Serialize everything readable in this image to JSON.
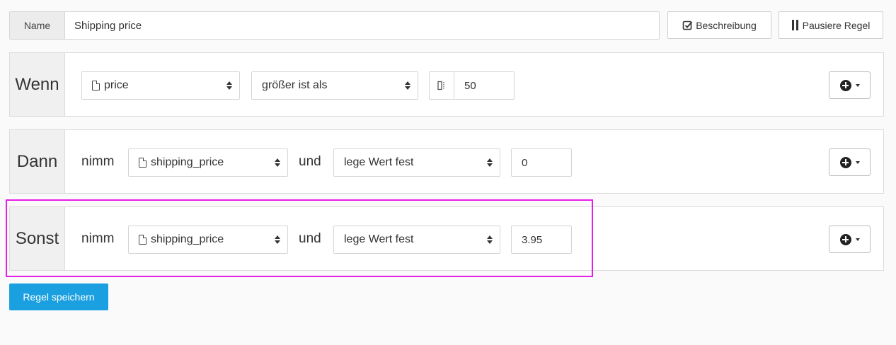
{
  "name_row": {
    "label": "Name",
    "value": "Shipping price"
  },
  "buttons": {
    "description": "Beschreibung",
    "pause": "Pausiere Regel",
    "save": "Regel speichern"
  },
  "wenn": {
    "label": "Wenn",
    "field": "price",
    "operator": "größer ist als",
    "value": "50"
  },
  "dann": {
    "label": "Dann",
    "take": "nimm",
    "field": "shipping_price",
    "and": "und",
    "action": "lege Wert fest",
    "value": "0"
  },
  "sonst": {
    "label": "Sonst",
    "take": "nimm",
    "field": "shipping_price",
    "and": "und",
    "action": "lege Wert fest",
    "value": "3.95"
  },
  "colors": {
    "primary": "#1aa0e0",
    "highlight": "#e61ee6"
  }
}
